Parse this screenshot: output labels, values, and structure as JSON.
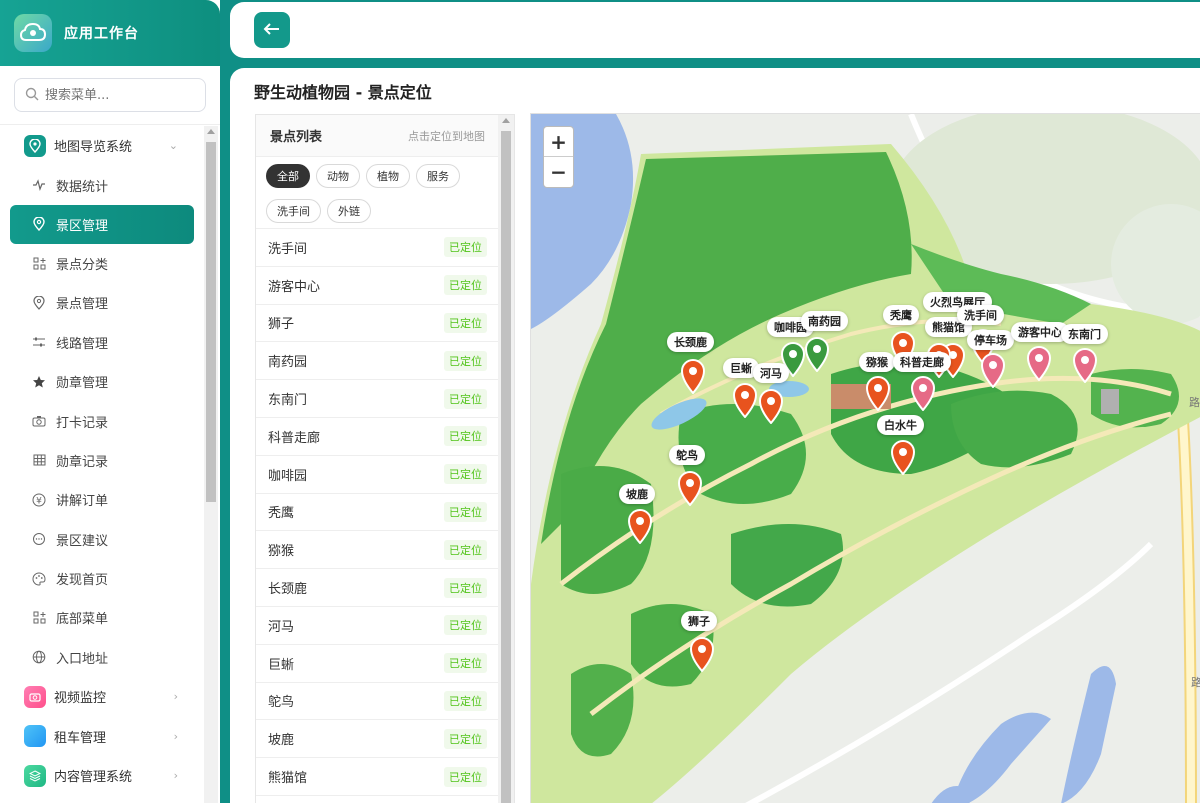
{
  "app": {
    "title": "应用工作台",
    "search_placeholder": "搜索菜单..."
  },
  "menu": {
    "map_system": "地图导览系统",
    "items": [
      {
        "label": "数据统计",
        "icon": "chart-line-icon"
      },
      {
        "label": "景区管理",
        "icon": "location-pin-icon",
        "active": true
      },
      {
        "label": "景点分类",
        "icon": "grid-plus-icon"
      },
      {
        "label": "景点管理",
        "icon": "location-pin-icon"
      },
      {
        "label": "线路管理",
        "icon": "sliders-icon"
      },
      {
        "label": "勋章管理",
        "icon": "star-icon"
      },
      {
        "label": "打卡记录",
        "icon": "camera-icon"
      },
      {
        "label": "勋章记录",
        "icon": "table-icon"
      },
      {
        "label": "讲解订单",
        "icon": "yen-icon"
      },
      {
        "label": "景区建议",
        "icon": "chat-bubble-icon"
      },
      {
        "label": "发现首页",
        "icon": "palette-icon"
      },
      {
        "label": "底部菜单",
        "icon": "grid-plus-icon"
      },
      {
        "label": "入口地址",
        "icon": "globe-icon"
      }
    ],
    "video_monitor": "视频监控",
    "car_rental": "租车管理",
    "content_system": "内容管理系统"
  },
  "page": {
    "title": "野生动植物园 - 景点定位"
  },
  "spot_list": {
    "title": "景点列表",
    "hint": "点击定位到地图",
    "filters": [
      "全部",
      "动物",
      "植物",
      "服务",
      "洗手间",
      "外链"
    ],
    "active_filter": "全部",
    "rows": [
      {
        "name": "洗手间",
        "status": "已定位"
      },
      {
        "name": "游客中心",
        "status": "已定位"
      },
      {
        "name": "狮子",
        "status": "已定位"
      },
      {
        "name": "南药园",
        "status": "已定位"
      },
      {
        "name": "东南门",
        "status": "已定位"
      },
      {
        "name": "科普走廊",
        "status": "已定位"
      },
      {
        "name": "咖啡园",
        "status": "已定位"
      },
      {
        "name": "秃鹰",
        "status": "已定位"
      },
      {
        "name": "猕猴",
        "status": "已定位"
      },
      {
        "name": "长颈鹿",
        "status": "已定位"
      },
      {
        "name": "河马",
        "status": "已定位"
      },
      {
        "name": "巨蜥",
        "status": "已定位"
      },
      {
        "name": "鸵鸟",
        "status": "已定位"
      },
      {
        "name": "坡鹿",
        "status": "已定位"
      },
      {
        "name": "熊猫馆",
        "status": "已定位"
      }
    ]
  },
  "map": {
    "zoom_in": "+",
    "zoom_out": "−",
    "labels": {
      "giraffe": "长颈鹿",
      "coffee": "咖啡园",
      "nanyao": "南药园",
      "lizard": "巨蜥",
      "hippo": "河马",
      "vulture": "秃鹰",
      "flamingo": "火烈鸟展厅",
      "panda": "熊猫馆",
      "toilet": "洗手间",
      "parking": "停车场",
      "visitor": "游客中心",
      "southeast": "东南门",
      "macaque": "猕猴",
      "science": "科普走廊",
      "whiteox": "白水牛",
      "ostrich": "鸵鸟",
      "deer": "坡鹿",
      "lion": "狮子"
    },
    "road_1": "路",
    "road_2": "路"
  }
}
